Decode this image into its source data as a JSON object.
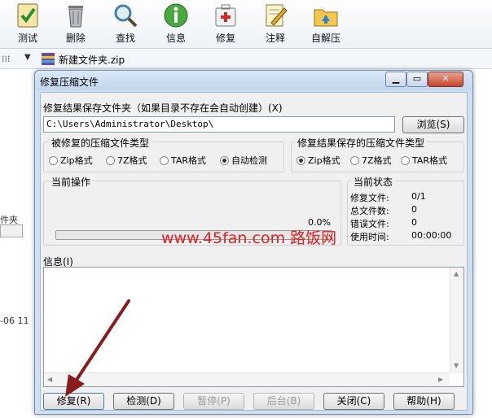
{
  "toolbar": {
    "items": [
      {
        "label": "测试",
        "icon": "test-icon"
      },
      {
        "label": "删除",
        "icon": "trash-icon"
      },
      {
        "label": "查找",
        "icon": "magnifier-icon"
      },
      {
        "label": "信息",
        "icon": "info-icon"
      },
      {
        "label": "修复",
        "icon": "repair-kit-icon"
      },
      {
        "label": "注释",
        "icon": "comment-icon"
      },
      {
        "label": "自解压",
        "icon": "sfx-folder-icon"
      }
    ]
  },
  "addressbar": {
    "path": "新建文件夹.zip"
  },
  "background": {
    "frag_1": "件夹",
    "frag_2": "-06 11"
  },
  "dialog": {
    "title": "修复压缩文件",
    "save_folder_label": "修复结果保存文件夹（如果目录不存在会自动创建）(X)",
    "save_folder_value": "C:\\Users\\Administrator\\Desktop\\",
    "browse_button": "浏览(S)",
    "source_type": {
      "title": "被修复的压缩文件类型",
      "options": [
        "Zip格式",
        "7Z格式",
        "TAR格式",
        "自动检测"
      ],
      "selected": "自动检测"
    },
    "result_type": {
      "title": "修复结果保存的压缩文件类型",
      "options": [
        "Zip格式",
        "7Z格式",
        "TAR格式"
      ],
      "selected": "Zip格式"
    },
    "current_operation": {
      "title": "当前操作",
      "percent_text": "0.0%",
      "progress": 0
    },
    "current_status": {
      "title": "当前状态",
      "rows": [
        {
          "label": "修复文件:",
          "value": "0/1"
        },
        {
          "label": "总文件数:",
          "value": "0"
        },
        {
          "label": "错误文件:",
          "value": "0"
        },
        {
          "label": "使用时间:",
          "value": "00:00:00"
        }
      ]
    },
    "info_label": "信息(I)",
    "buttons": {
      "repair": "修复(R)",
      "check": "检测(D)",
      "pause": "暂停(P)",
      "background": "后台(B)",
      "close": "关闭(C)",
      "help": "帮助(H)"
    }
  },
  "watermark": "www.45fan.com 路饭网",
  "colors": {
    "watermark": "#e41f1f",
    "arrow": "#8b1c1c",
    "title_bar": "#c3d7ef",
    "dialog_face": "#f0f0f0"
  }
}
